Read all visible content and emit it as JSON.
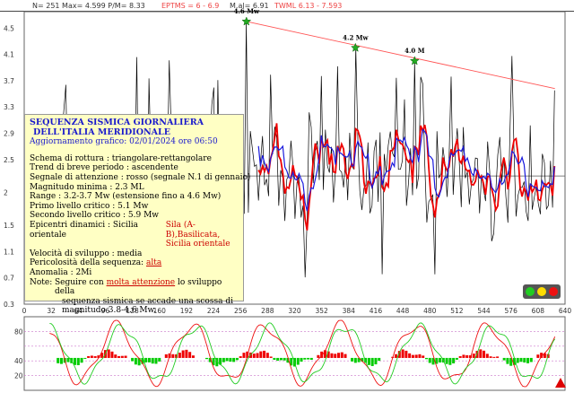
{
  "header": {
    "stats": "N= 251 Max= 4.599 P/M= 8.33",
    "eptms": "EPTMS = 6 - 6.9",
    "mal": "M.al= 6.91",
    "twml": "TWML 6.13 - 7.593"
  },
  "info_box": {
    "title1": "SEQUENZA SISMICA GIORNALIERA",
    "title2": "DELL'ITALIA MERIDIONALE",
    "updated": "Aggiornamento grafico: 02/01/2024 ore 06:50",
    "rows": [
      "Schema di rottura : triangolare-rettangolare",
      "Trend di breve periodo  : ascendente",
      "Segnale di attenzione : rosso (segnale N.1 di gennaio)",
      "Magnitudo minima : 2.3 ML",
      "Range : 3.2-3.7 Mw (estensione fino a 4.6 Mw)",
      "Primo livello critico : 5.1 Mw",
      "Secondo livello critico : 5.9 Mw"
    ],
    "epicentri_label": "Epicentri dinamici : Sicilia orientale",
    "epicentri_value1": "Sila (A-B),Basilicata,",
    "epicentri_value2": "Sicilia orientale",
    "velocita": "Velocità di sviluppo : media",
    "pericolosita_label": "Pericolosità della sequenza:",
    "pericolosita_value": "alta",
    "anomalia": "Anomalia : 2Mi",
    "note_label": "Note:",
    "note_pre": "Seguire con",
    "note_highlight": "molta attenzione",
    "note_post": "lo sviluppo della",
    "note_line2": "sequenza sismica se accade una scossa di",
    "note_line3": "magnitudo 3.8-4.6 Mw."
  },
  "colors": {
    "raw": "#000000",
    "avg_red": "#ee0000",
    "avg_blue": "#1a1add",
    "trend": "#ff5555",
    "peak_marker": "#22aa22",
    "osc_red": "#ee1111",
    "osc_green": "#22cc22",
    "osc_bar_up": "#ee0000",
    "osc_bar_down": "#00cc00",
    "grid": "#cc77cc"
  },
  "chart_data": {
    "type": "line",
    "x_ticks": [
      0,
      32,
      64,
      96,
      128,
      160,
      192,
      224,
      256,
      288,
      320,
      352,
      384,
      416,
      448,
      480,
      512,
      544,
      576,
      608,
      640
    ],
    "y_ticks": [
      "4.5",
      "4.1",
      "3.7",
      "3.3",
      "2.9",
      "2.5",
      "2",
      "1.5",
      "1.1",
      "0.7",
      "0.3"
    ],
    "ylim": [
      0.3,
      4.75
    ],
    "xlim": [
      0,
      640
    ],
    "annotations": [
      {
        "label": "4.6 Mw",
        "x": 263,
        "y": 4.6
      },
      {
        "label": "4.2 Mw",
        "x": 392,
        "y": 4.2
      },
      {
        "label": "4.0 M",
        "x": 462,
        "y": 4.0
      }
    ],
    "trend_line": {
      "x": [
        263,
        628
      ],
      "y": [
        4.6,
        3.58
      ]
    },
    "reference_line_y": 2.25,
    "oscillator": {
      "y_ticks": [
        "80",
        "40",
        "20"
      ],
      "levels": [
        80,
        60,
        40,
        20
      ],
      "ylim": [
        0,
        100
      ]
    }
  }
}
